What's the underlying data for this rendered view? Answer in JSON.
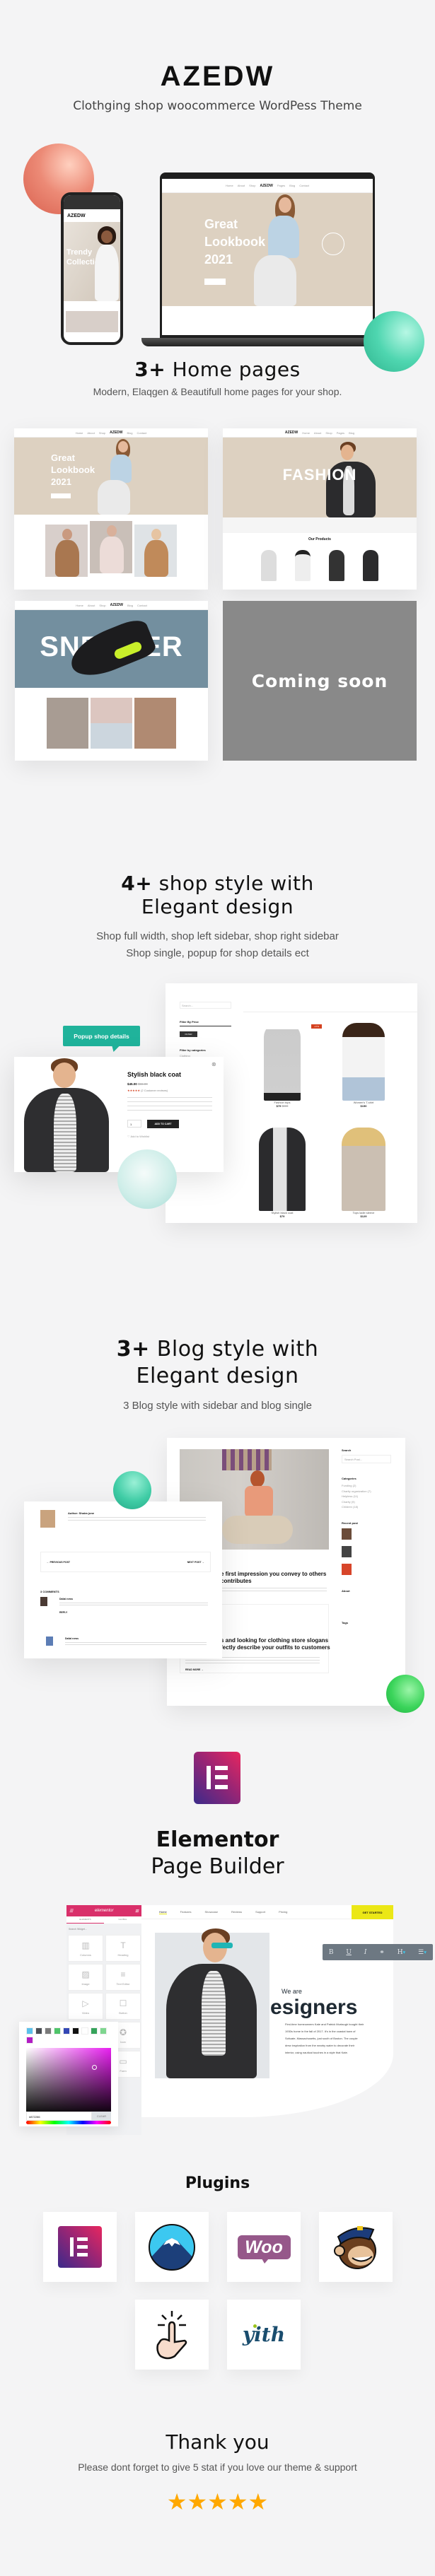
{
  "header": {
    "logo": "AZEDW",
    "tagline": "Clothging  shop woocommerce WordPess Theme"
  },
  "hero": {
    "phone": {
      "logo": "AZEDW",
      "banner_line1": "Trendy",
      "banner_line2": "Collection"
    },
    "laptop": {
      "logo": "AZEDW",
      "banner_line1": "Great",
      "banner_line2": "Lookbook",
      "banner_line3": "2021"
    }
  },
  "home_pages": {
    "title_bold": "3+",
    "title_rest": " Home pages",
    "subtitle": "Modern, Elaqgen & Beautifull home pages for your shop.",
    "demos": [
      {
        "logo": "AZEDW",
        "banner_line1": "Great",
        "banner_line2": "Lookbook",
        "banner_line3": "2021"
      },
      {
        "logo": "AZEDW",
        "banner": "FASHION",
        "section_title": "Our Products"
      },
      {
        "logo": "AZEDW",
        "banner": "SNEAKER"
      },
      {
        "label": "Coming soon"
      }
    ]
  },
  "shop": {
    "title_bold": "4+",
    "title_line1": " shop style with",
    "title_line2": "Elegant design",
    "subtitle_line1": "Shop full width, shop left sidebar, shop right sidebar",
    "subtitle_line2": "Shop single, popup for shop details ect",
    "badge": "Popup shop details",
    "popup": {
      "name": "Stylish black coat",
      "price": "$45.00",
      "old_price": "$55.00",
      "reviews": "(2 Customer reviews)",
      "qty": "1",
      "add_to_cart": "ADD TO CART",
      "wishlist": "Add to Wishlist"
    },
    "sidebar": {
      "search_placeholder": "Search...",
      "filter_price": "Filter By Price",
      "filter_button": "FILTER",
      "filter_categories": "Filter by categories",
      "category": "Clothing"
    },
    "sale_badge": "-17%",
    "products": [
      {
        "name": "Fashion tops",
        "price": "$79",
        "old_price": "$109"
      },
      {
        "name": "Women's T-shirt",
        "price": "$150"
      },
      {
        "name": "Stylish black coat",
        "price": "$79"
      },
      {
        "name": "Tops ladie sleeve",
        "price": "$129"
      }
    ],
    "accent": "#20b39b"
  },
  "blog": {
    "title_bold": "3+",
    "title_line1": " Blog style with",
    "title_line2": "Elegant design",
    "subtitle": "3 Blog style with sidebar and blog single",
    "post1_line1": "e first impression you convey to others",
    "post1_line2": "contributes",
    "post2_line1": "s and looking for clothing store slogans",
    "post2_line2": "fectly describe your outfits to customers",
    "read_more": "READ MORE →",
    "sidebar": {
      "search": "Search",
      "search_placeholder": "Search Post...",
      "categories": "Categories",
      "category_items": [
        "Funding (2)",
        "Charity organization (7)",
        "Helpless (11)",
        "Charity (9)",
        "Children (18)"
      ],
      "recent": "Recent post",
      "about": "About",
      "tags": "Tags"
    },
    "author": "Author: Shaira jone",
    "prev": "← PREVIOUS POST",
    "next": "NEXT POST →",
    "comments_title": "3 COMMENTS",
    "commenters": [
      "Dalial news",
      "Dalial news"
    ],
    "reply": "REPLY"
  },
  "elementor": {
    "title_line1": "Elementor",
    "title_line2": "Page Builder",
    "panel": {
      "brand": "elementor",
      "tab_elements": "ELEMENTS",
      "tab_global": "GLOBAL",
      "search": "Search Widget...",
      "widgets": [
        "Columns",
        "Heading",
        "Image",
        "Text Editor",
        "Video",
        "Button",
        "Spacer",
        "Icon",
        "Portfolio",
        "Form"
      ]
    },
    "nav": [
      "Home",
      "Features",
      "Showcase",
      "Reviews",
      "Support",
      "Pricing"
    ],
    "cta": "GET STARTED",
    "we_are": "We are",
    "headline": "esigners",
    "body": "First-time homeowners Kate and Patrick Murtaugh bought their 1930s home in the fall of 2017. It's in the coastal town of Scituate, Massachusetts, just south of Boston. The couple drew inspiration from the nearby water to decorate their interior, using nautical touches in a style that Kate.",
    "picker": {
      "hex": "#872286",
      "clear": "CLEAR",
      "swatches": [
        "#5bc0eb",
        "#4a4e54",
        "#7a7a7a",
        "#4fc46a",
        "#3347b5",
        "#111111",
        "#ffffff",
        "#35a35a",
        "#7ed68f",
        "#b21cc4"
      ]
    },
    "brand_color": "#d92f6a"
  },
  "plugins": {
    "title": "Plugins",
    "items": [
      "elementor-icon",
      "kirki-icon",
      "woocommerce-icon",
      "mailchimp-icon",
      "one-click-demo-import-icon",
      "yith-icon"
    ],
    "woo": "Woo",
    "yith": "yith"
  },
  "footer": {
    "title": "Thank you",
    "subtitle": "Please dont forget to give 5 stat if you love our theme & support",
    "rating": 5,
    "star_color": "#ffa800"
  }
}
